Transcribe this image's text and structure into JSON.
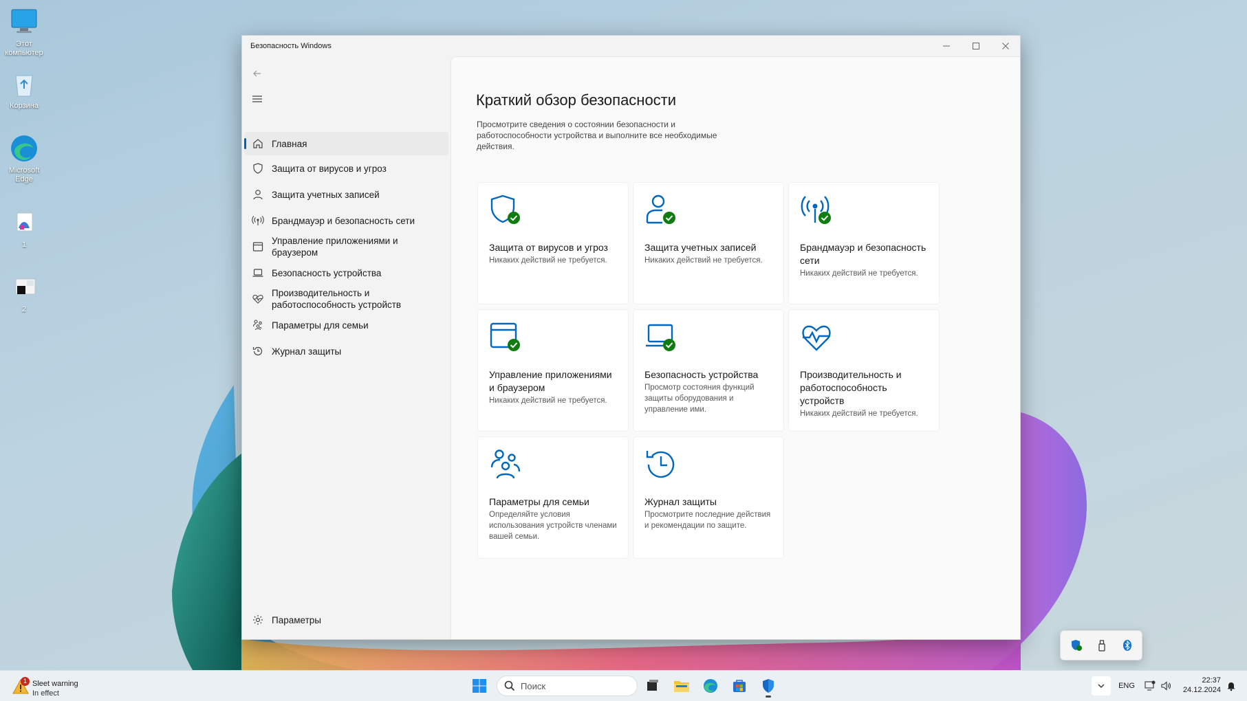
{
  "desktop": {
    "icons": [
      {
        "label": "Этот компьютер",
        "icon": "monitor-icon"
      },
      {
        "label": "Корзина",
        "icon": "recycle-bin-icon"
      },
      {
        "label": "Microsoft Edge",
        "icon": "edge-icon"
      },
      {
        "label": "1",
        "icon": "file-icon"
      },
      {
        "label": "2",
        "icon": "image-file-icon"
      }
    ]
  },
  "window": {
    "title": "Безопасность Windows",
    "controls": {
      "minimize": "minimize-icon",
      "maximize": "maximize-icon",
      "close": "close-icon"
    }
  },
  "sidebar": {
    "items": [
      {
        "label": "Главная",
        "icon": "home-icon",
        "active": true
      },
      {
        "label": "Защита от вирусов и угроз",
        "icon": "shield-icon"
      },
      {
        "label": "Защита учетных записей",
        "icon": "person-icon"
      },
      {
        "label": "Брандмауэр и безопасность сети",
        "icon": "antenna-icon"
      },
      {
        "label": "Управление приложениями и браузером",
        "icon": "app-window-icon"
      },
      {
        "label": "Безопасность устройства",
        "icon": "laptop-icon"
      },
      {
        "label": "Производительность и работоспособность устройств",
        "icon": "heart-pulse-icon"
      },
      {
        "label": "Параметры для семьи",
        "icon": "family-icon"
      },
      {
        "label": "Журнал защиты",
        "icon": "history-icon"
      }
    ],
    "settings_label": "Параметры"
  },
  "main": {
    "heading": "Краткий обзор безопасности",
    "intro": "Просмотрите сведения о состоянии безопасности и работоспособности устройства и выполните все необходимые действия.",
    "cards": [
      {
        "title": "Защита от вирусов и угроз",
        "desc": "Никаких действий не требуется.",
        "icon": "shield-check-icon"
      },
      {
        "title": "Защита учетных записей",
        "desc": "Никаких действий не требуется.",
        "icon": "person-check-icon"
      },
      {
        "title": "Брандмауэр и безопасность сети",
        "desc": "Никаких действий не требуется.",
        "icon": "antenna-check-icon"
      },
      {
        "title": "Управление приложениями и браузером",
        "desc": "Никаких действий не требуется.",
        "icon": "app-window-check-icon"
      },
      {
        "title": "Безопасность устройства",
        "desc": "Просмотр состояния функций защиты оборудования и управление ими.",
        "icon": "laptop-check-icon"
      },
      {
        "title": "Производительность и работоспособность устройств",
        "desc": "Никаких действий не требуется.",
        "icon": "heart-pulse-icon"
      },
      {
        "title": "Параметры для семьи",
        "desc": "Определяйте условия использования устройств членами вашей семьи.",
        "icon": "family-icon"
      },
      {
        "title": "Журнал защиты",
        "desc": "Просмотрите последние действия и рекомендации по защите.",
        "icon": "history-icon"
      }
    ]
  },
  "taskbar": {
    "weather": {
      "title": "Sleet warning",
      "subtitle": "In effect",
      "badge": "1"
    },
    "search_placeholder": "Поиск",
    "apps": [
      "start-icon",
      "task-view-icon",
      "file-explorer-icon",
      "edge-icon",
      "store-icon",
      "windows-security-icon"
    ],
    "lang": "ENG",
    "time": "22:37",
    "date": "24.12.2024"
  },
  "colors": {
    "accent": "#005fb8",
    "icon_blue": "#0067c0",
    "check_green": "#107c10"
  }
}
